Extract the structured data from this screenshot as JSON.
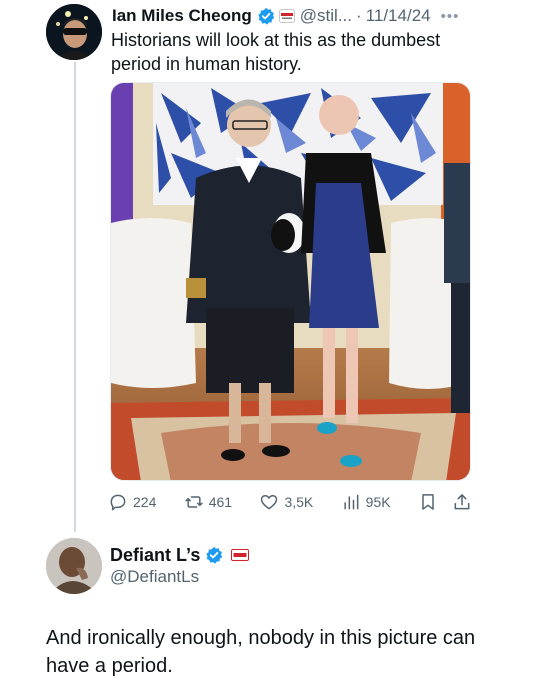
{
  "tweet": {
    "author_name": "Ian Miles Cheong",
    "handle": "@stil...",
    "separator": "·",
    "date": "11/14/24",
    "text": "Historians will look at this as the dumbest period in human history.",
    "more_icon": "more-icon",
    "stats": {
      "replies": "224",
      "reposts": "461",
      "likes": "3,5K",
      "views": "95K"
    }
  },
  "reply": {
    "author_name": "Defiant L’s",
    "handle": "@DefiantLs",
    "text": "And ironically enough, nobody in this picture can have a period."
  },
  "colors": {
    "verified_blue": "#1d9bf0",
    "muted_text": "#536471",
    "thread_line": "#cfd9de",
    "rtm_red": "#d2232a"
  }
}
